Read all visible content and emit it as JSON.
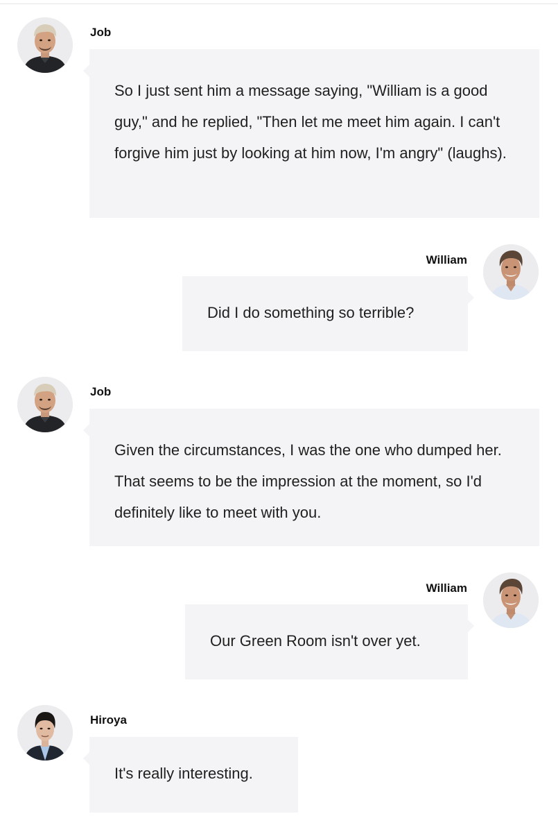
{
  "messages": [
    {
      "side": "left",
      "speaker": "Job",
      "avatar": "job-avatar",
      "text": "So I just sent him a message saying, \"William is a good guy,\" and he replied, \"Then let me meet him again. I can't forgive him just by looking at him now, I'm angry\" (laughs)."
    },
    {
      "side": "right",
      "speaker": "William",
      "avatar": "william-avatar",
      "text": "Did I do something so terrible?"
    },
    {
      "side": "left",
      "speaker": "Job",
      "avatar": "job-avatar",
      "text": "Given the circumstances, I was the one who dumped her. That seems to be the impression at the moment, so I'd definitely like to meet with you."
    },
    {
      "side": "right",
      "speaker": "William",
      "avatar": "william-avatar",
      "text": "Our Green Room isn't over yet."
    },
    {
      "side": "left",
      "speaker": "Hiroya",
      "avatar": "hiroya-avatar",
      "text": "It's really interesting."
    }
  ],
  "colors": {
    "bubble_bg": "#f4f4f6",
    "name_text": "#111111",
    "body_text": "#1f1f1f",
    "divider": "#e4e5e8"
  }
}
